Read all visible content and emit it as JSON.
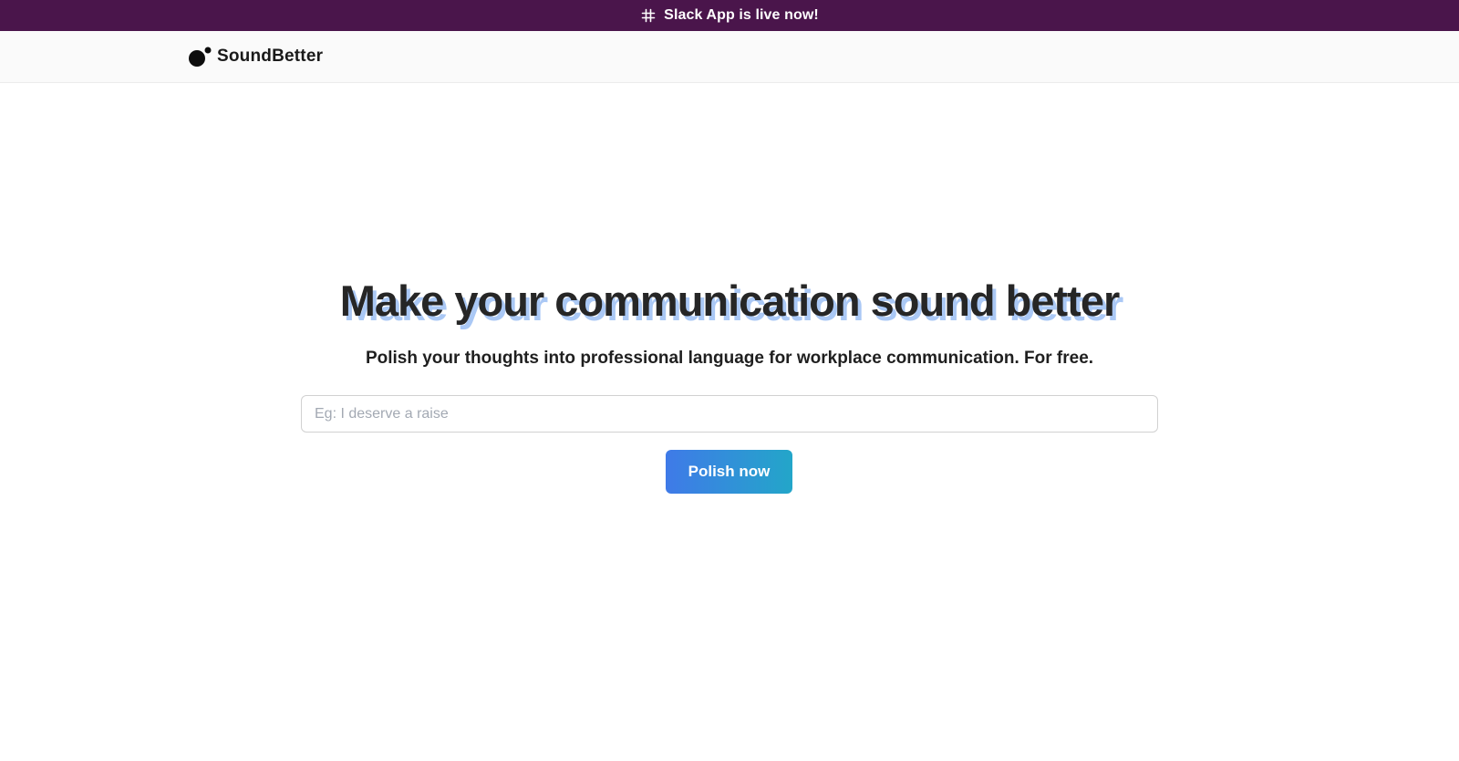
{
  "announcement": {
    "icon": "slack-icon",
    "text": "Slack App is live now!",
    "background_color": "#4a154b"
  },
  "navbar": {
    "logo_icon": "soundbetter-logo-icon",
    "brand_name": "SoundBetter"
  },
  "hero": {
    "title": "Make your communication sound better",
    "subtitle": "Polish your thoughts into professional language for workplace communication. For free.",
    "title_shadow_color": "#aac8f5"
  },
  "form": {
    "input_value": "",
    "input_placeholder": "Eg: I deserve a raise",
    "submit_label": "Polish now",
    "button_gradient": [
      "#3f7ae8",
      "#23a6c9"
    ]
  }
}
